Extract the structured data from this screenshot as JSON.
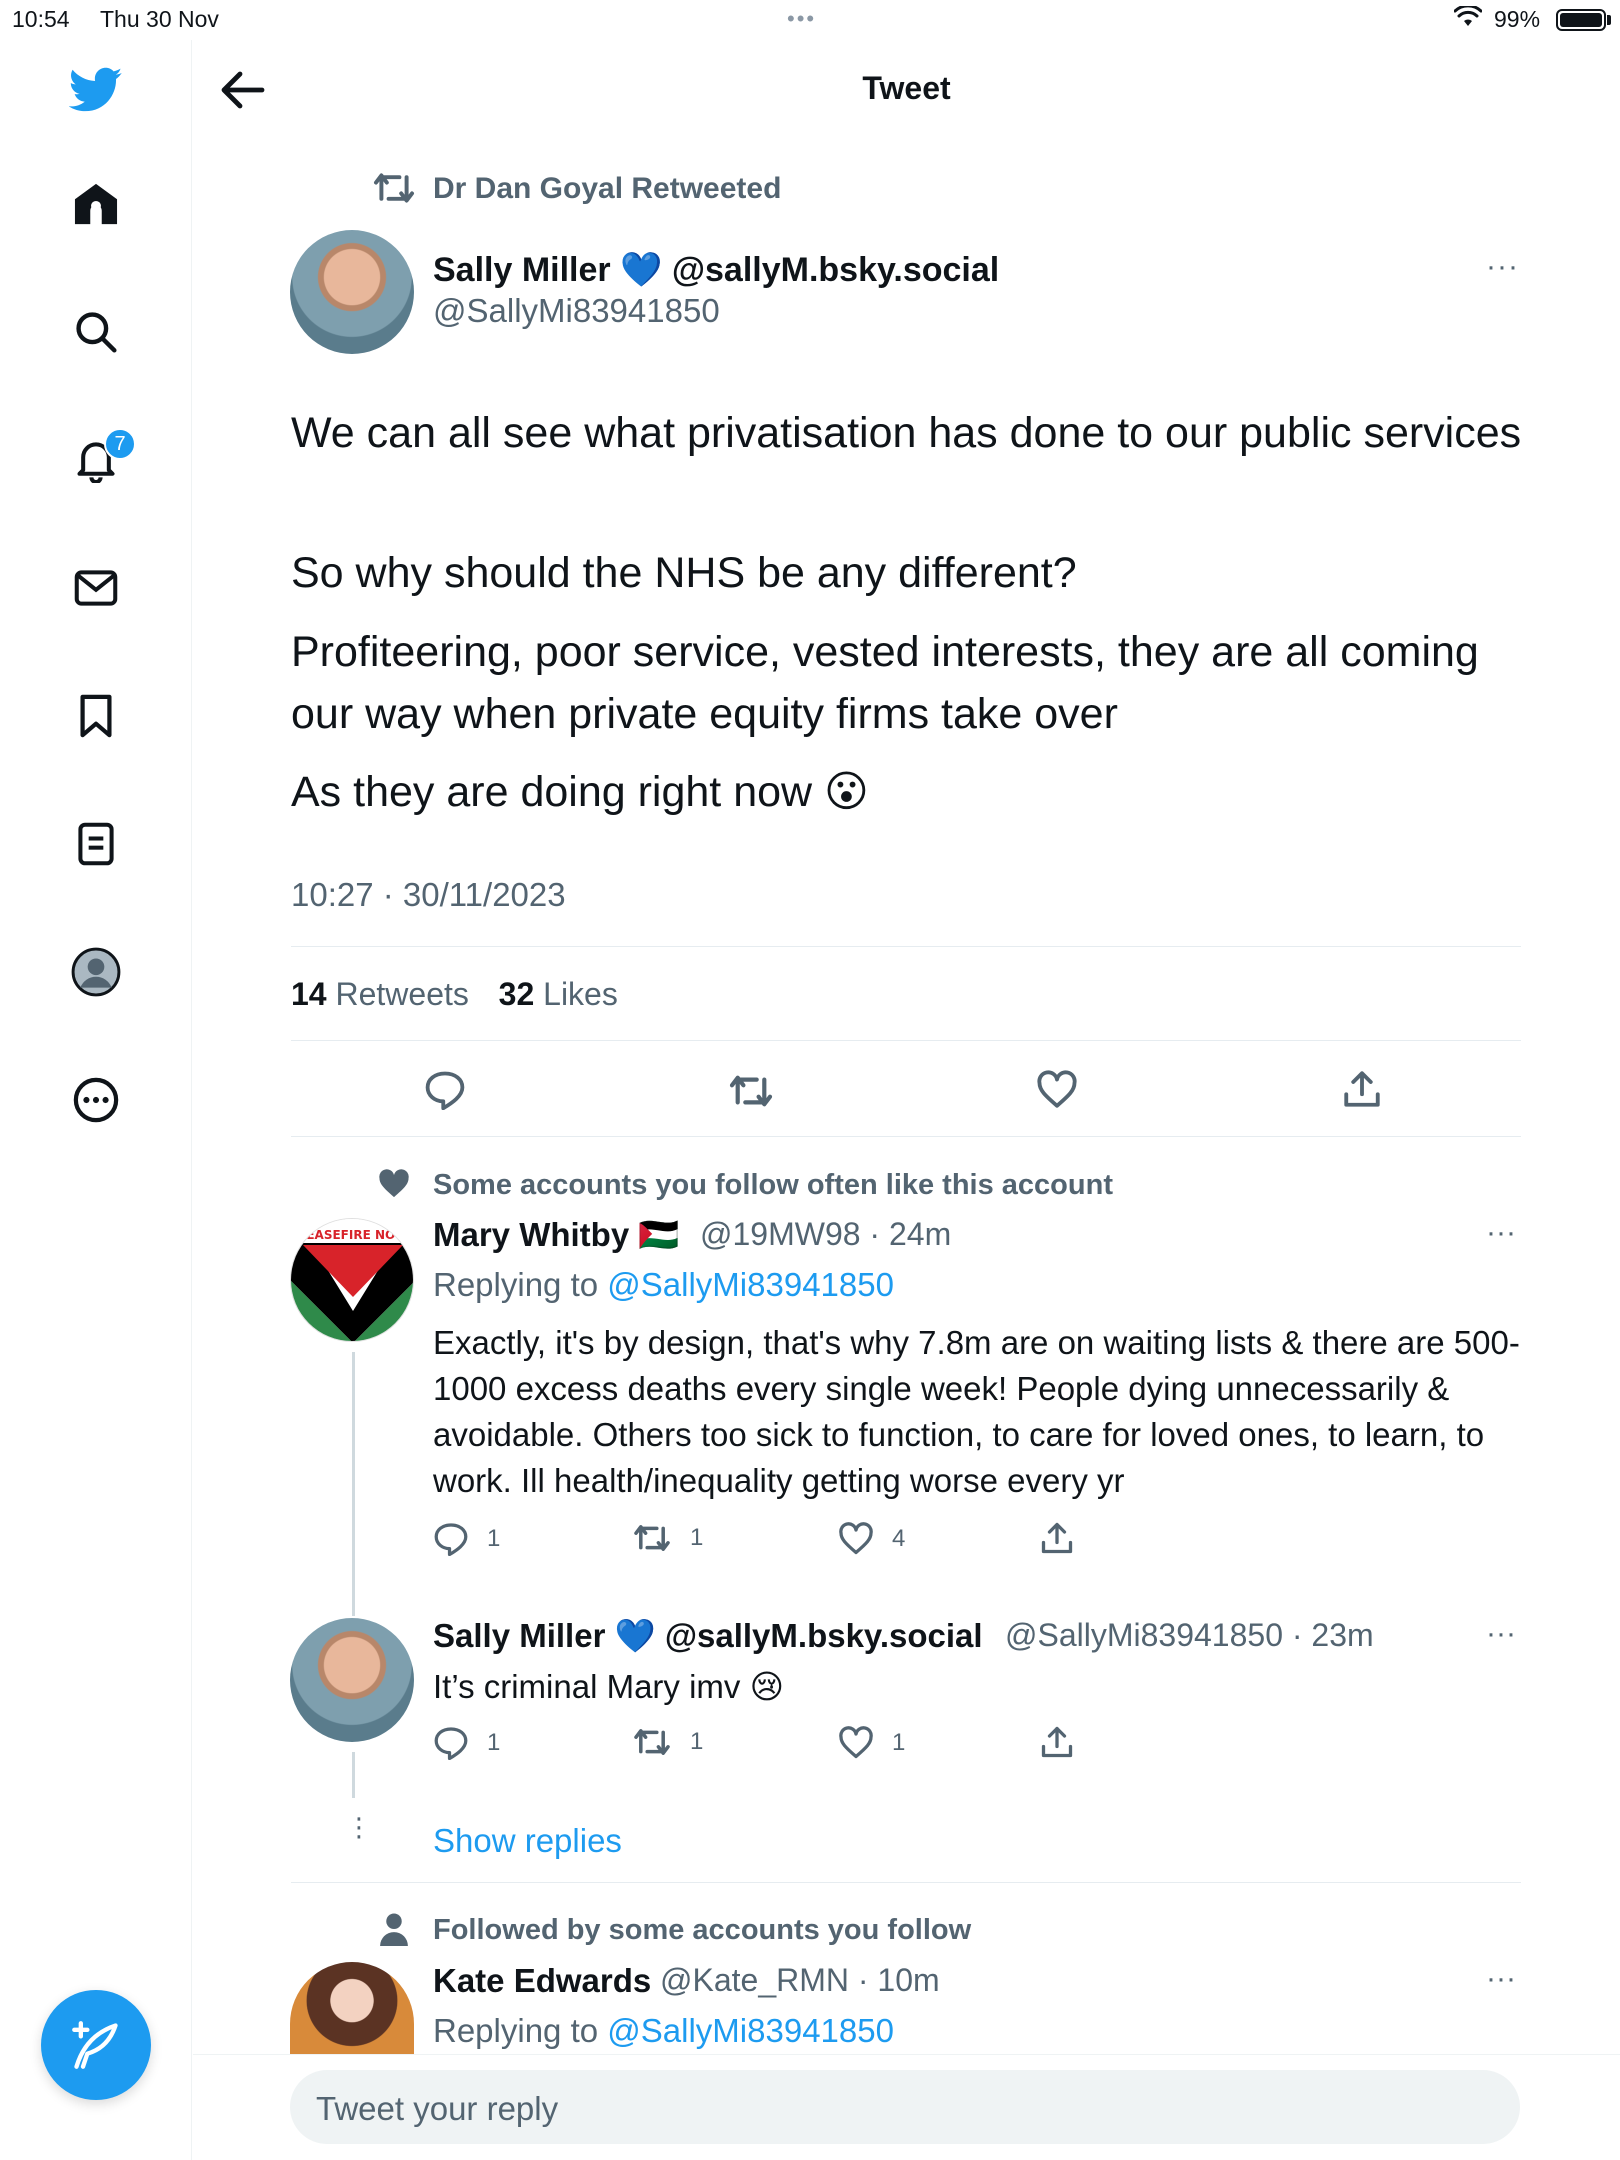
{
  "status_bar": {
    "time": "10:54",
    "date": "Thu 30 Nov",
    "dots": "•••",
    "battery": "99%"
  },
  "sidebar": {
    "notification_count": "7"
  },
  "header": {
    "title": "Tweet"
  },
  "main_tweet": {
    "retweeted_by": "Dr Dan Goyal Retweeted",
    "author_name": "Sally Miller 💙 @sallyM.bsky.social",
    "author_handle": "@SallyMi83941850",
    "paragraphs": [
      "We can all see what privatisation has done to our public services",
      "So why should the NHS be any different?",
      "Profiteering, poor service, vested interests, they are all coming our way when private equity firms take over",
      "As they are doing right now 😮"
    ],
    "timestamp": "10:27 · 30/11/2023",
    "retweets_count": "14",
    "retweets_label": "Retweets",
    "likes_count": "32",
    "likes_label": "Likes"
  },
  "replies": [
    {
      "context": "Some accounts you follow often like this account",
      "name": "Mary Whitby 🇵🇸",
      "meta": "@19MW98 · 24m",
      "replying_prefix": "Replying to",
      "replying_to": "@SallyMi83941850",
      "text": "Exactly, it's by design, that's why 7.8m are on waiting lists & there are 500-1000 excess deaths every single week! People dying unnecessarily & avoidable. Others too sick to function, to care for loved ones, to learn, to work. Ill health/inequality getting worse every yr",
      "reply_count": "1",
      "retweet_count": "1",
      "like_count": "4",
      "avatar_text": "CEASEFIRE NOW"
    },
    {
      "name": "Sally Miller 💙 @sallyM.bsky.social",
      "meta": "@SallyMi83941850 · 23m",
      "text": "It’s criminal Mary imv 😢",
      "reply_count": "1",
      "retweet_count": "1",
      "like_count": "1"
    },
    {
      "context": "Followed by some accounts you follow",
      "name": "Kate Edwards",
      "meta": "@Kate_RMN · 10m",
      "replying_prefix": "Replying to",
      "replying_to": "@SallyMi83941850"
    }
  ],
  "show_replies": "Show replies",
  "reply_box": {
    "placeholder": "Tweet your reply"
  },
  "colors": {
    "accent": "#1d9bf0",
    "text": "#0f1419",
    "muted": "#536471"
  }
}
